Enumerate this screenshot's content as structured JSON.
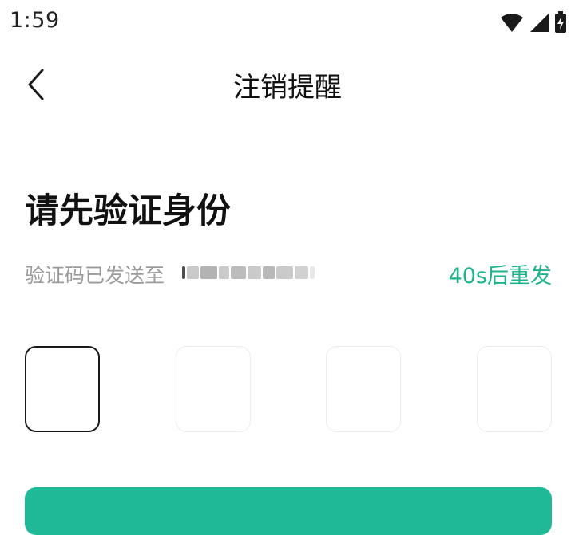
{
  "status_bar": {
    "time": "1:59",
    "icons": [
      "wifi-icon",
      "signal-icon",
      "battery-charging-icon"
    ]
  },
  "nav": {
    "back_icon": "chevron-left-icon",
    "title": "注销提醒"
  },
  "main": {
    "heading": "请先验证身份",
    "sent_label": "验证码已发送至",
    "resend_label": "40s后重发",
    "code_length": 4
  },
  "colors": {
    "accent": "#1fb38c",
    "button": "#1fb997",
    "active_border": "#1a1a1a",
    "inactive_border": "#ececec",
    "muted_text": "#9a9a9a"
  }
}
